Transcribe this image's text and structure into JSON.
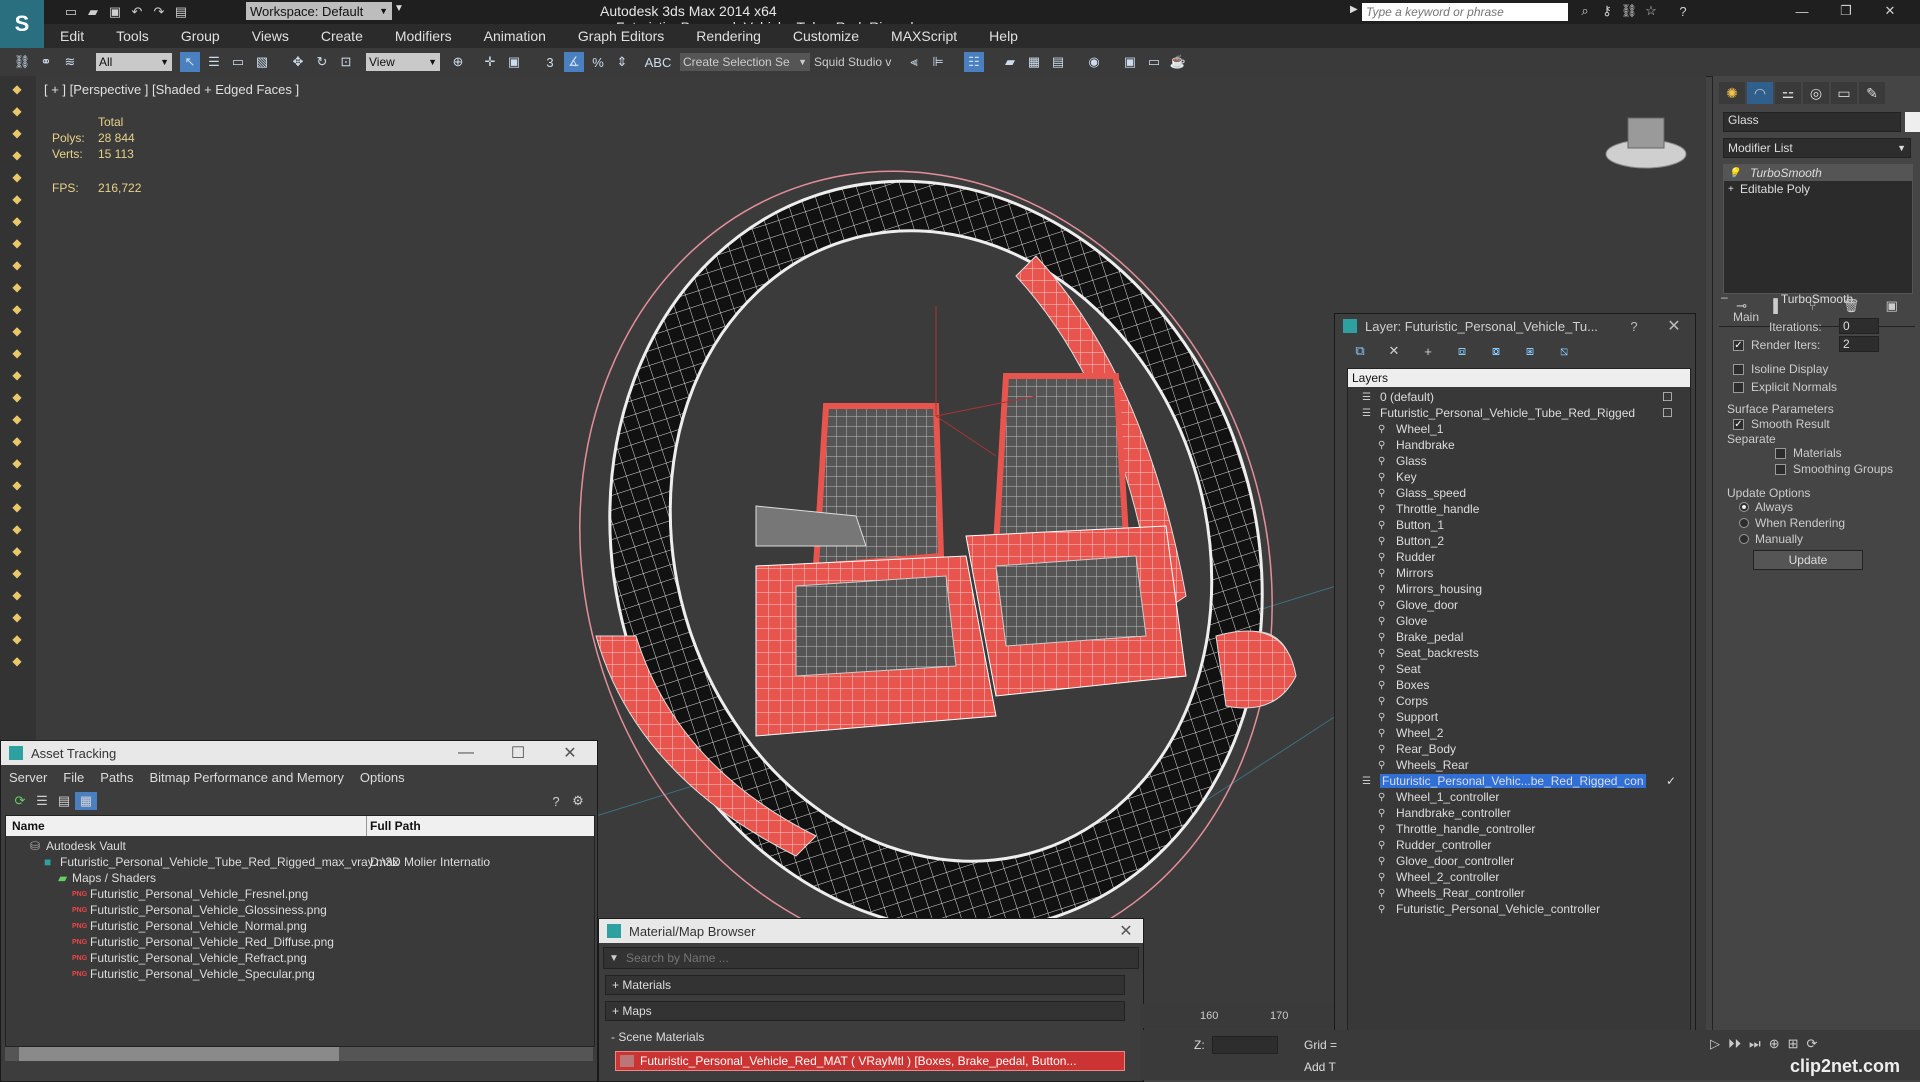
{
  "titlebar": {
    "app_title": "Autodesk 3ds Max  2014 x64",
    "file_title": "Futuristic_Personal_Vehicle_Tube_Red_Rigged_max_vray.max",
    "workspace": "Workspace: Default",
    "search_placeholder": "Type a keyword or phrase"
  },
  "menu": [
    "Edit",
    "Tools",
    "Group",
    "Views",
    "Create",
    "Modifiers",
    "Animation",
    "Graph Editors",
    "Rendering",
    "Customize",
    "MAXScript",
    "Help"
  ],
  "toolbar": {
    "filter": "All",
    "ref_coord": "View",
    "selection_set": "Create Selection Se",
    "workspace_tag": "Squid Studio v"
  },
  "viewport": {
    "label": "[ + ] [Perspective ] [Shaded + Edged Faces ]",
    "stats": {
      "total_label": "Total",
      "polys_label": "Polys:",
      "polys_value": "28 844",
      "verts_label": "Verts:",
      "verts_value": "15 113",
      "fps_label": "FPS:",
      "fps_value": "216,722"
    }
  },
  "command_panel": {
    "object_name": "Glass",
    "modifier_list": "Modifier List",
    "stack": [
      "TurboSmooth",
      "Editable Poly"
    ],
    "rollout": "TurboSmooth",
    "main_label": "Main",
    "iterations_label": "Iterations:",
    "iterations_value": "0",
    "render_iters_label": "Render Iters:",
    "render_iters_value": "2",
    "isoline": "Isoline Display",
    "explicit_normals": "Explicit Normals",
    "surface_params": "Surface Parameters",
    "smooth_result": "Smooth Result",
    "separate": "Separate",
    "materials": "Materials",
    "smoothing_groups": "Smoothing Groups",
    "update_options": "Update Options",
    "always": "Always",
    "when_rendering": "When Rendering",
    "manually": "Manually",
    "update_button": "Update"
  },
  "layer_window": {
    "title": "Layer: Futuristic_Personal_Vehicle_Tu...",
    "help": "?",
    "header": "Layers",
    "layers": [
      {
        "name": "0 (default)",
        "indent": 0
      },
      {
        "name": "Futuristic_Personal_Vehicle_Tube_Red_Rigged",
        "indent": 0
      },
      {
        "name": "Wheel_1",
        "indent": 1
      },
      {
        "name": "Handbrake",
        "indent": 1
      },
      {
        "name": "Glass",
        "indent": 1
      },
      {
        "name": "Key",
        "indent": 1
      },
      {
        "name": "Glass_speed",
        "indent": 1
      },
      {
        "name": "Throttle_handle",
        "indent": 1
      },
      {
        "name": "Button_1",
        "indent": 1
      },
      {
        "name": "Button_2",
        "indent": 1
      },
      {
        "name": "Rudder",
        "indent": 1
      },
      {
        "name": "Mirrors",
        "indent": 1
      },
      {
        "name": "Mirrors_housing",
        "indent": 1
      },
      {
        "name": "Glove_door",
        "indent": 1
      },
      {
        "name": "Glove",
        "indent": 1
      },
      {
        "name": "Brake_pedal",
        "indent": 1
      },
      {
        "name": "Seat_backrests",
        "indent": 1
      },
      {
        "name": "Seat",
        "indent": 1
      },
      {
        "name": "Boxes",
        "indent": 1
      },
      {
        "name": "Corps",
        "indent": 1
      },
      {
        "name": "Support",
        "indent": 1
      },
      {
        "name": "Wheel_2",
        "indent": 1
      },
      {
        "name": "Rear_Body",
        "indent": 1
      },
      {
        "name": "Wheels_Rear",
        "indent": 1
      },
      {
        "name": "Futuristic_Personal_Vehic...be_Red_Rigged_con",
        "indent": 0,
        "selected": true
      },
      {
        "name": "Wheel_1_controller",
        "indent": 1
      },
      {
        "name": "Handbrake_controller",
        "indent": 1
      },
      {
        "name": "Throttle_handle_controller",
        "indent": 1
      },
      {
        "name": "Rudder_controller",
        "indent": 1
      },
      {
        "name": "Glove_door_controller",
        "indent": 1
      },
      {
        "name": "Wheel_2_controller",
        "indent": 1
      },
      {
        "name": "Wheels_Rear_controller",
        "indent": 1
      },
      {
        "name": "Futuristic_Personal_Vehicle_controller",
        "indent": 1
      }
    ]
  },
  "asset_tracking": {
    "title": "Asset Tracking",
    "menu": [
      "Server",
      "File",
      "Paths",
      "Bitmap Performance and Memory",
      "Options"
    ],
    "col_name": "Name",
    "col_path": "Full Path",
    "rows": [
      {
        "name": "Autodesk Vault",
        "path": "",
        "indent": 1,
        "kind": "vault"
      },
      {
        "name": "Futuristic_Personal_Vehicle_Tube_Red_Rigged_max_vray.max",
        "path": "D:\\3D Molier Internatio",
        "indent": 2,
        "kind": "max"
      },
      {
        "name": "Maps / Shaders",
        "path": "",
        "indent": 3,
        "kind": "folder"
      },
      {
        "name": "Futuristic_Personal_Vehicle_Fresnel.png",
        "path": "",
        "indent": 4,
        "kind": "png"
      },
      {
        "name": "Futuristic_Personal_Vehicle_Glossiness.png",
        "path": "",
        "indent": 4,
        "kind": "png"
      },
      {
        "name": "Futuristic_Personal_Vehicle_Normal.png",
        "path": "",
        "indent": 4,
        "kind": "png"
      },
      {
        "name": "Futuristic_Personal_Vehicle_Red_Diffuse.png",
        "path": "",
        "indent": 4,
        "kind": "png"
      },
      {
        "name": "Futuristic_Personal_Vehicle_Refract.png",
        "path": "",
        "indent": 4,
        "kind": "png"
      },
      {
        "name": "Futuristic_Personal_Vehicle_Specular.png",
        "path": "",
        "indent": 4,
        "kind": "png"
      }
    ]
  },
  "material_browser": {
    "title": "Material/Map Browser",
    "search_placeholder": "Search by Name ...",
    "groups": [
      "+ Materials",
      "+ Maps",
      "- Scene Materials"
    ],
    "scene_material": "Futuristic_Personal_Vehicle_Red_MAT  ( VRayMtl ) [Boxes, Brake_pedal, Button..."
  },
  "timeline": {
    "ticks": [
      "160",
      "170"
    ],
    "z_label": "Z:",
    "grid_label": "Grid =",
    "add_label": "Add T"
  },
  "watermark": "clip2net.com",
  "colors": {
    "accent_red": "#e8554e",
    "selection_blue": "#2f6fd6"
  }
}
